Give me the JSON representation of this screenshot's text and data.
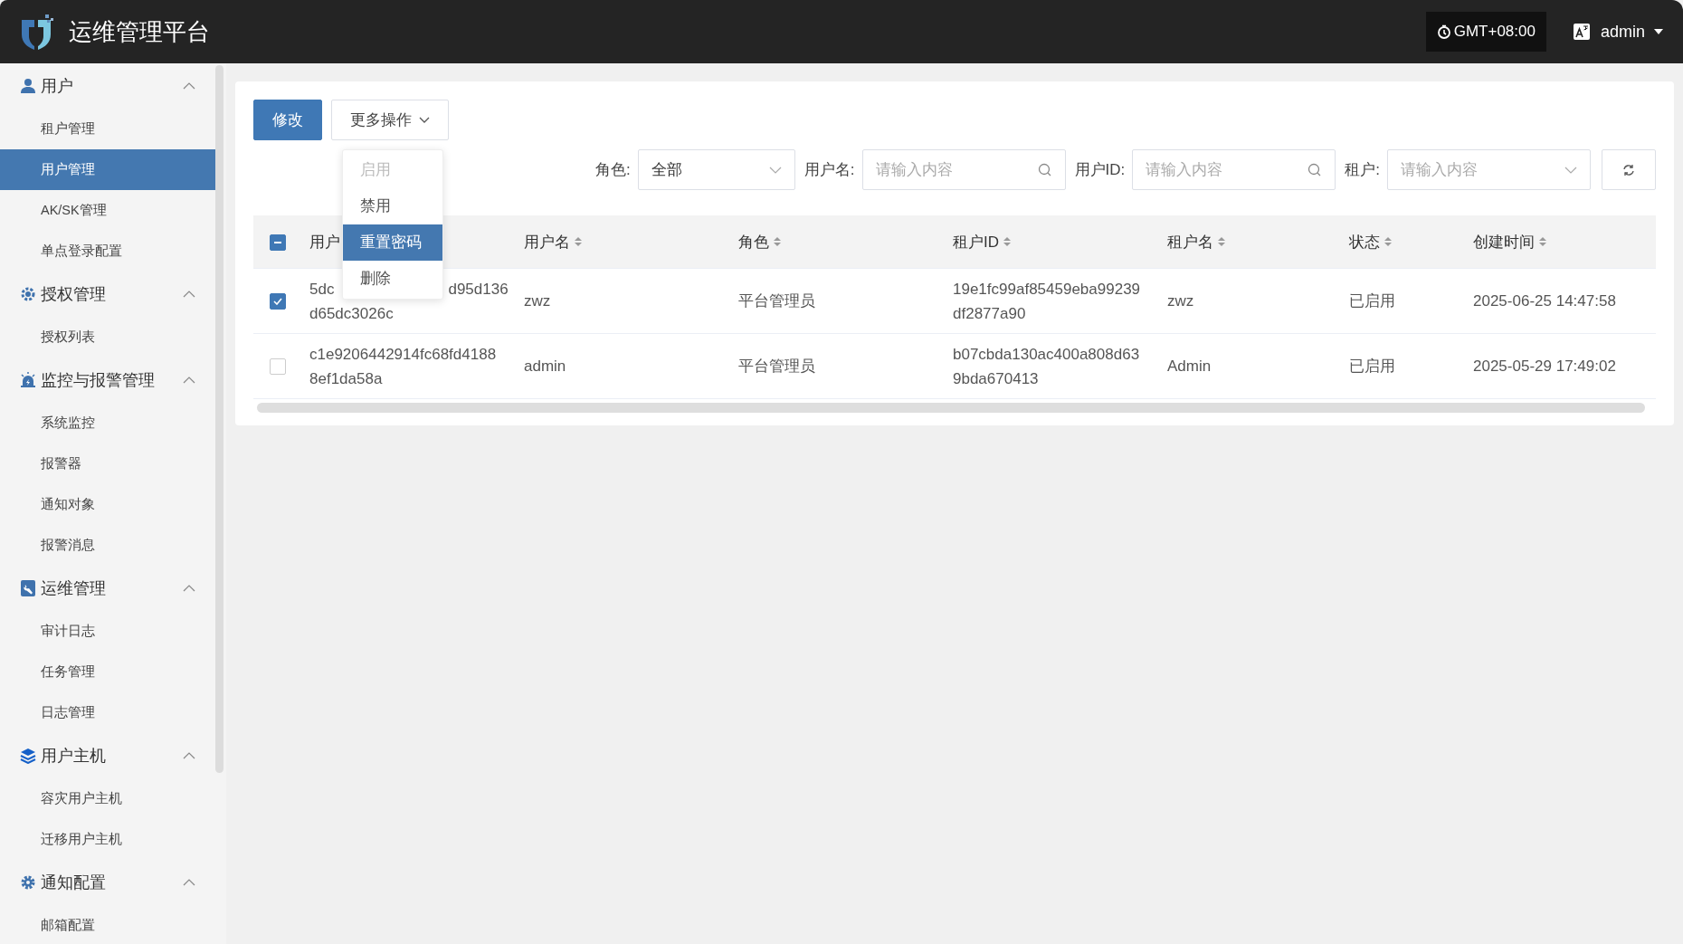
{
  "header": {
    "title": "运维管理平台",
    "timezone": "GMT+08:00",
    "user": "admin"
  },
  "sidebar": {
    "groups": [
      {
        "label": "用户",
        "expanded": true,
        "items": [
          {
            "label": "租户管理",
            "selected": false
          },
          {
            "label": "用户管理",
            "selected": true
          },
          {
            "label": "AK/SK管理",
            "selected": false
          },
          {
            "label": "单点登录配置",
            "selected": false
          }
        ]
      },
      {
        "label": "授权管理",
        "expanded": true,
        "items": [
          {
            "label": "授权列表",
            "selected": false
          }
        ]
      },
      {
        "label": "监控与报警管理",
        "expanded": true,
        "items": [
          {
            "label": "系统监控",
            "selected": false
          },
          {
            "label": "报警器",
            "selected": false
          },
          {
            "label": "通知对象",
            "selected": false
          },
          {
            "label": "报警消息",
            "selected": false
          }
        ]
      },
      {
        "label": "运维管理",
        "expanded": true,
        "items": [
          {
            "label": "审计日志",
            "selected": false
          },
          {
            "label": "任务管理",
            "selected": false
          },
          {
            "label": "日志管理",
            "selected": false
          }
        ]
      },
      {
        "label": "用户主机",
        "expanded": true,
        "items": [
          {
            "label": "容灾用户主机",
            "selected": false
          },
          {
            "label": "迁移用户主机",
            "selected": false
          }
        ]
      },
      {
        "label": "通知配置",
        "expanded": true,
        "items": [
          {
            "label": "邮箱配置",
            "selected": false
          }
        ]
      }
    ]
  },
  "toolbar": {
    "edit_button": "修改",
    "more_button": "更多操作",
    "more_menu": [
      {
        "label": "启用",
        "disabled": true,
        "selected": false
      },
      {
        "label": "禁用",
        "disabled": false,
        "selected": false
      },
      {
        "label": "重置密码",
        "disabled": false,
        "selected": true
      },
      {
        "label": "删除",
        "disabled": false,
        "selected": false
      }
    ]
  },
  "filters": [
    {
      "kind": "select",
      "label": "角色:",
      "value": "全部"
    },
    {
      "kind": "search",
      "label": "用户名:",
      "placeholder": "请输入内容"
    },
    {
      "kind": "search",
      "label": "用户ID:",
      "placeholder": "请输入内容"
    },
    {
      "kind": "select",
      "label": "租户:",
      "placeholder": "请输入内容"
    }
  ],
  "table": {
    "select_all": {
      "indeterminate": true
    },
    "columns": [
      "用户",
      "用户名",
      "角色",
      "租户ID",
      "租户名",
      "状态",
      "创建时间"
    ],
    "rows": [
      {
        "checked": true,
        "column_1": [
          [
            "5dc",
            "d95d136"
          ],
          [
            "d65dc3026c"
          ]
        ],
        "username": "zwz",
        "role": "平台管理员",
        "tenant_id": [
          "19e1fc99af85459eba99239",
          "df2877a90"
        ],
        "tenant_name": "zwz",
        "status": "已启用",
        "created": "2025-06-25 14:47:58"
      },
      {
        "checked": false,
        "column_1": [
          [
            "c1e9206442914fc68fd4188"
          ],
          [
            "8ef1da58a"
          ]
        ],
        "username": "admin",
        "role": "平台管理员",
        "tenant_id": [
          "b07cbda130ac400a808d63",
          "9bda670413"
        ],
        "tenant_name": "Admin",
        "status": "已启用",
        "created": "2025-05-29 17:49:02"
      }
    ]
  }
}
